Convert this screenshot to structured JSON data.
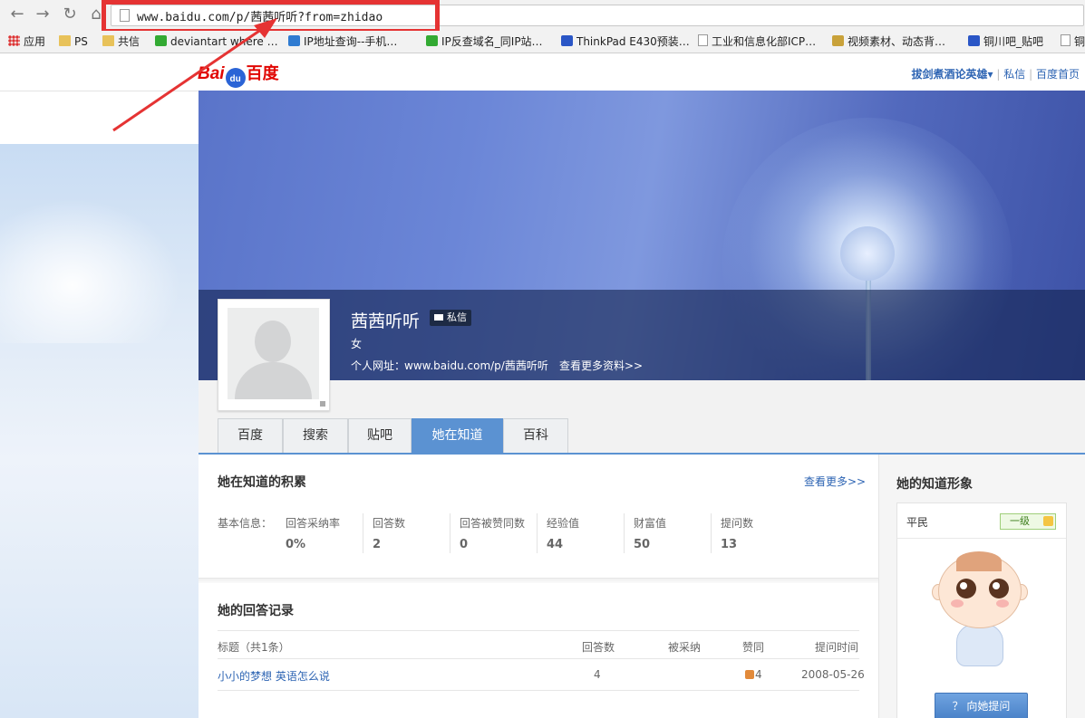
{
  "browser": {
    "url": "www.baidu.com/p/茜茜听听?from=zhidao",
    "bookmarks": [
      {
        "label": "应用",
        "icon": "apps-icon"
      },
      {
        "label": "PS",
        "icon": "folder-icon"
      },
      {
        "label": "共信",
        "icon": "folder-icon"
      },
      {
        "label": "deviantart where …",
        "icon": "green-leaf-icon"
      },
      {
        "label": "IP地址查询--手机…",
        "icon": "x-icon"
      },
      {
        "label": "IP反查域名_同IP站…",
        "icon": "green-leaf-icon"
      },
      {
        "label": "ThinkPad E430预装…",
        "icon": "paw-icon"
      },
      {
        "label": "工业和信息化部ICP…",
        "icon": "page-icon"
      },
      {
        "label": "视频素材、动态背…",
        "icon": "gold-icon"
      },
      {
        "label": "铜川吧_贴吧",
        "icon": "paw-icon"
      },
      {
        "label": "铜",
        "icon": "page-icon"
      }
    ]
  },
  "header": {
    "logo": {
      "text_left": "Bai",
      "text_paw": "du",
      "text_right": "百度"
    },
    "user": "拔剑煮酒论英雄▾",
    "sep": "|",
    "links": [
      "私信",
      "百度首页"
    ]
  },
  "profile": {
    "name": "茜茜听听",
    "message_button": "私信",
    "gender": "女",
    "url_label": "个人网址：",
    "url": "www.baidu.com/p/茜茜听听",
    "more_info": "查看更多资料>>"
  },
  "tabs": [
    {
      "label": "百度",
      "active": false
    },
    {
      "label": "搜索",
      "active": false
    },
    {
      "label": "贴吧",
      "active": false
    },
    {
      "label": "她在知道",
      "active": true
    },
    {
      "label": "百科",
      "active": false
    }
  ],
  "knowledge": {
    "title": "她在知道的积累",
    "more": "查看更多>>",
    "basic_label": "基本信息：",
    "stats": [
      {
        "label": "回答采纳率",
        "value": "0%"
      },
      {
        "label": "回答数",
        "value": "2"
      },
      {
        "label": "回答被赞同数",
        "value": "0"
      },
      {
        "label": "经验值",
        "value": "44"
      },
      {
        "label": "财富值",
        "value": "50"
      },
      {
        "label": "提问数",
        "value": "13"
      }
    ]
  },
  "answers": {
    "title": "她的回答记录",
    "headers": {
      "title": "标题（共1条）",
      "answer_count": "回答数",
      "adopted": "被采纳",
      "likes": "赞同",
      "time": "提问时间"
    },
    "rows": [
      {
        "title": "小小的梦想 英语怎么说",
        "answer_count": "4",
        "adopted": "",
        "likes": "4",
        "time": "2008-05-26"
      }
    ]
  },
  "sidebar": {
    "title": "她的知道形象",
    "rank_name": "平民",
    "rank_level": "一级",
    "ask_button": "？ 向她提问"
  },
  "colors": {
    "accent": "#5b92d2",
    "link": "#2d64b3",
    "annotation": "#e53333"
  }
}
